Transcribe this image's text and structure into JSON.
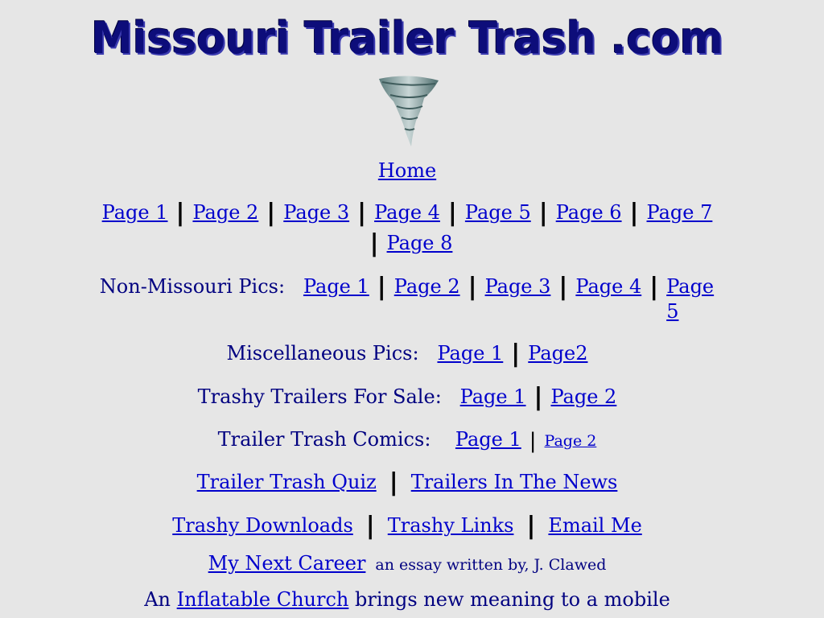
{
  "site": {
    "title": "Missouri Trailer Trash .com",
    "logo_icon": "tornado-icon"
  },
  "nav": {
    "home": "Home"
  },
  "pages": [
    "Page 1",
    "Page 2",
    "Page 3",
    "Page 4",
    "Page 5",
    "Page 6",
    "Page 7",
    "Page 8"
  ],
  "non_missouri": {
    "label": "Non-Missouri Pics:",
    "links": [
      "Page 1",
      "Page 2",
      "Page 3",
      "Page 4",
      "Page 5"
    ]
  },
  "misc": {
    "label": "Miscellaneous Pics:",
    "links": [
      "Page 1",
      "Page2"
    ]
  },
  "for_sale": {
    "label": "Trashy Trailers For Sale:",
    "links": [
      "Page 1",
      "Page 2"
    ]
  },
  "comics": {
    "label": "Trailer Trash Comics:",
    "links": [
      "Page 1",
      "Page 2"
    ]
  },
  "extras": {
    "quiz": "Trailer Trash Quiz",
    "news": "Trailers In The News"
  },
  "bottom_links": {
    "downloads": "Trashy Downloads",
    "links": "Trashy Links",
    "email": "Email Me"
  },
  "career": {
    "link": "My Next Career",
    "desc": "an essay written by,  J. Clawed"
  },
  "church": {
    "prefix": "An",
    "link": "Inflatable Church",
    "suffix": "brings new meaning to a mobile"
  },
  "separator": "|"
}
